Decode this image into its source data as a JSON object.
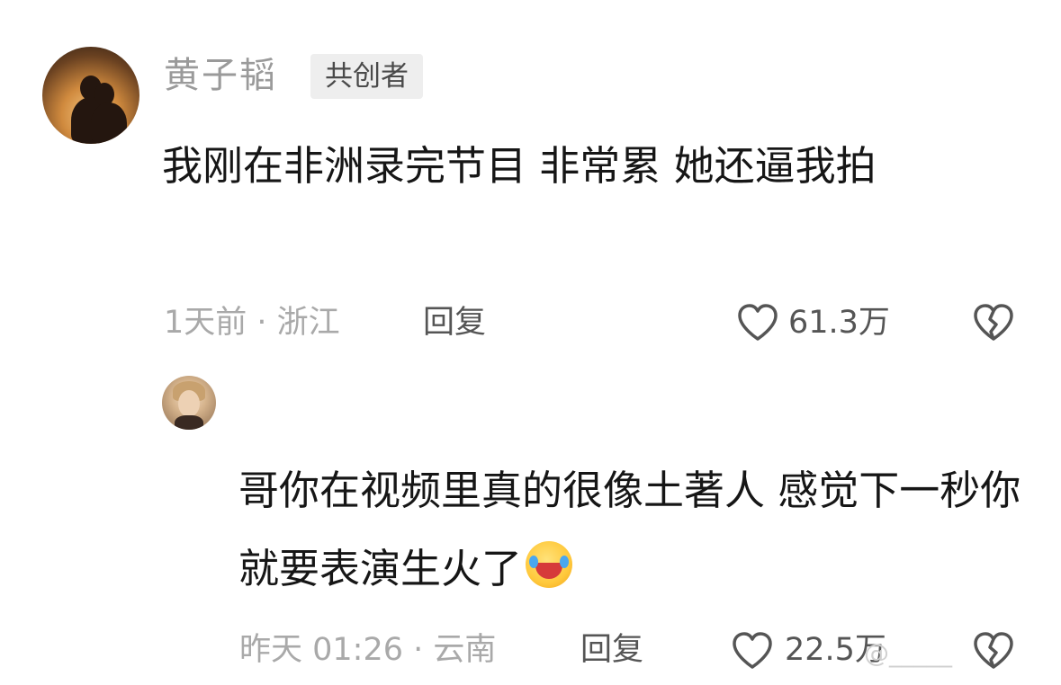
{
  "comments": [
    {
      "username": "黄子韬",
      "badge": "共创者",
      "text": "我刚在非洲录完节目 非常累 她还逼我拍",
      "meta": "1天前 · 浙江",
      "reply_label": "回复",
      "likes": "61.3万"
    },
    {
      "text": "哥你在视频里真的很像土著人 感觉下一秒你就要表演生火了",
      "emoji": "laughing-crying-emoji",
      "meta": "昨天 01:26 · 云南",
      "reply_label": "回复",
      "likes": "22.5万"
    }
  ],
  "watermark": "@_____"
}
